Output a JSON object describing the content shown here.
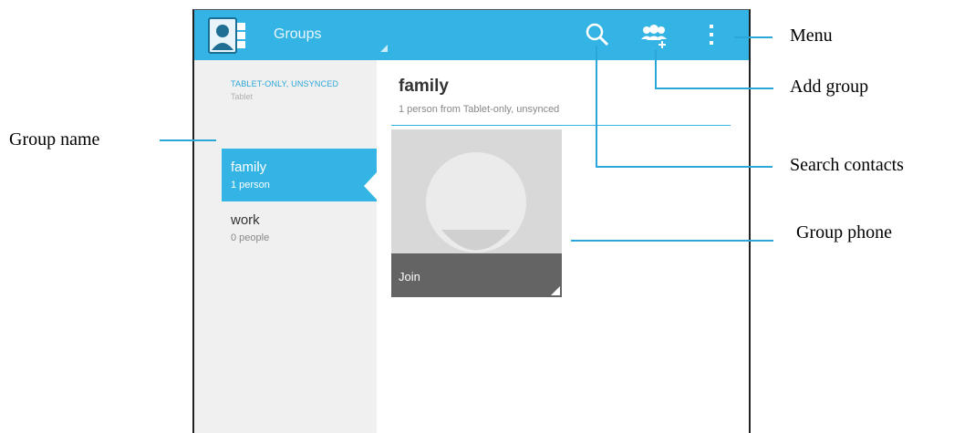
{
  "actionbar": {
    "title": "Groups",
    "color": "#34b4e4",
    "icons": [
      "contacts-app-icon",
      "search-icon",
      "add-group-icon",
      "overflow-menu-icon"
    ]
  },
  "sidebar": {
    "account_name": "TABLET-ONLY, UNSYNCED",
    "account_type": "Tablet",
    "groups": [
      {
        "name": "family",
        "count": "1 person",
        "selected": true
      },
      {
        "name": "work",
        "count": "0 people",
        "selected": false
      }
    ]
  },
  "detail": {
    "title": "family",
    "subtitle": "1 person from Tablet-only, unsynced",
    "card_label": "Join"
  },
  "annotations": {
    "menu": "Menu",
    "add_group": "Add group",
    "group_name": "Group name",
    "search_contacts": "Search contacts",
    "group_phone": "Group phone"
  }
}
